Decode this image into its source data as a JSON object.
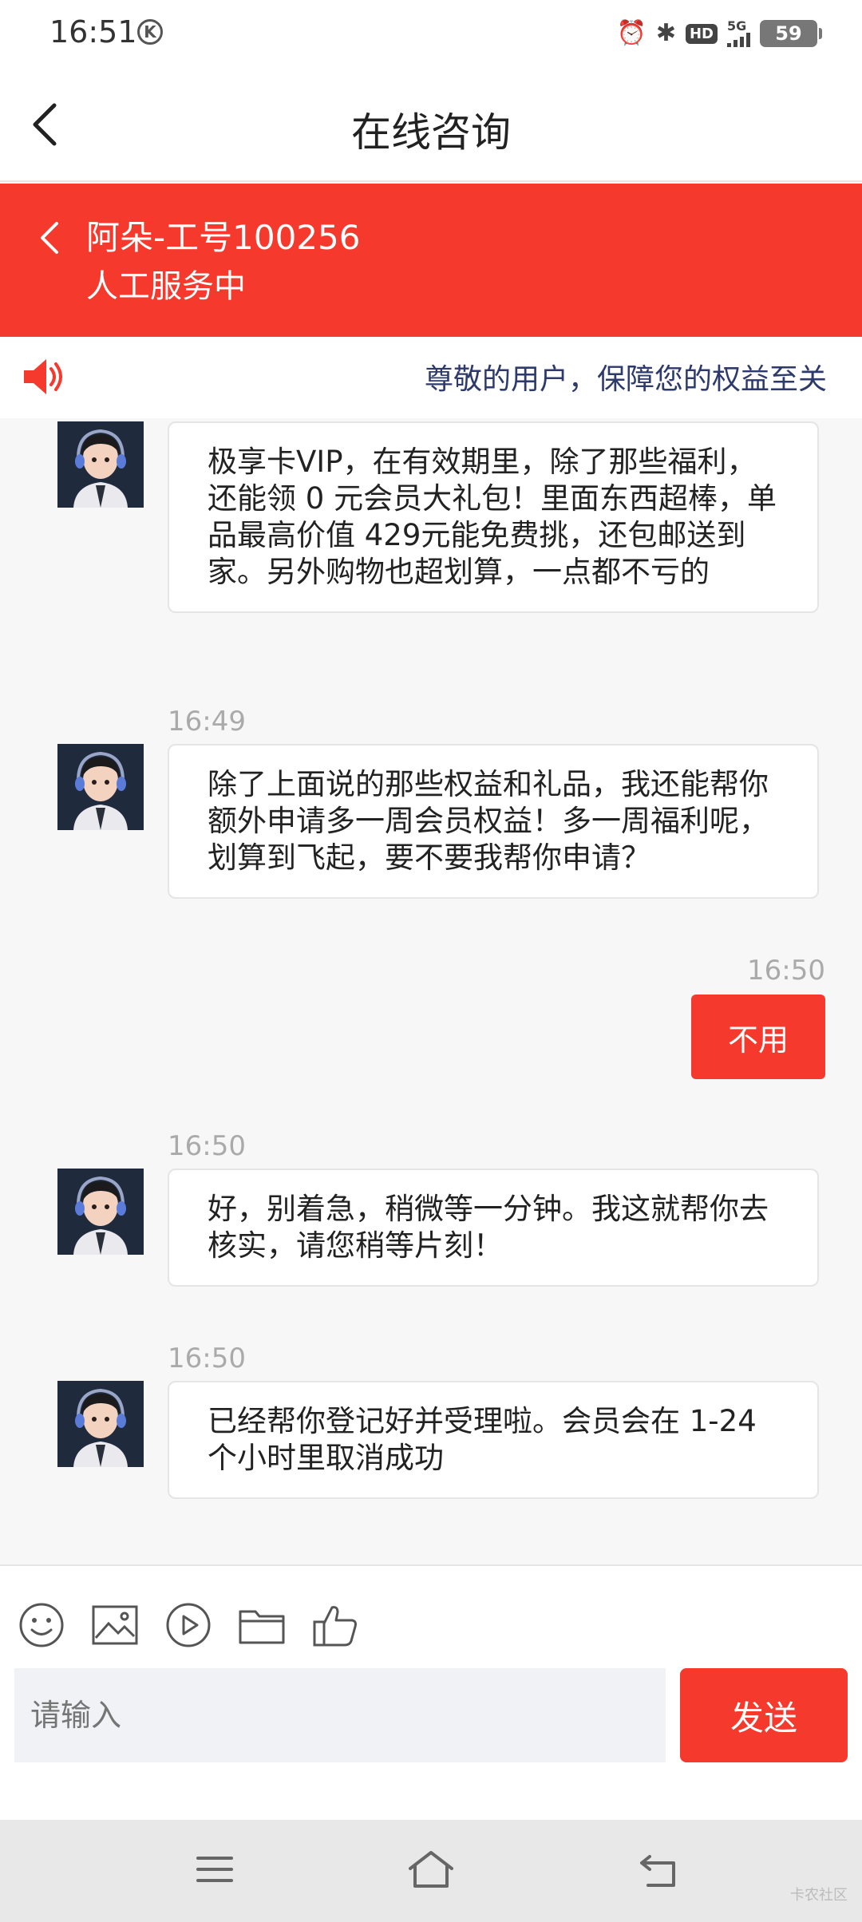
{
  "status_bar": {
    "time": "16:51",
    "k_badge": "K",
    "hd": "HD",
    "network": "5G",
    "battery": "59"
  },
  "header": {
    "title": "在线咨询"
  },
  "agent": {
    "name": "阿朵-工号100256",
    "status": "人工服务中"
  },
  "notice": {
    "text": "尊敬的用户，保障您的权益至关"
  },
  "messages": [
    {
      "sender": "agent",
      "time": "",
      "text": "极享卡VIP，在有效期里，除了那些福利，还能领 0 元会员大礼包！里面东西超棒，单品最高价值 429元能免费挑，还包邮送到家。另外购物也超划算，一点都不亏的"
    },
    {
      "sender": "agent",
      "time": "16:49",
      "text": "除了上面说的那些权益和礼品，我还能帮你额外申请多一周会员权益！多一周福利呢，划算到飞起，要不要我帮你申请？"
    },
    {
      "sender": "user",
      "time": "16:50",
      "text": "不用"
    },
    {
      "sender": "agent",
      "time": "16:50",
      "text": "好，别着急，稍微等一分钟。我这就帮你去核实，请您稍等片刻！"
    },
    {
      "sender": "agent",
      "time": "16:50",
      "text": "已经帮你登记好并受理啦。会员会在 1-24个小时里取消成功"
    }
  ],
  "input": {
    "placeholder": "请输入",
    "send_label": "发送"
  },
  "toolbar_icons": [
    "emoji-icon",
    "image-icon",
    "video-icon",
    "folder-icon",
    "thumbs-up-icon"
  ],
  "watermark": "卡农社区",
  "colors": {
    "accent": "#f6392d",
    "notice_text": "#2d3a6b",
    "timestamp": "#aaaaaa"
  }
}
